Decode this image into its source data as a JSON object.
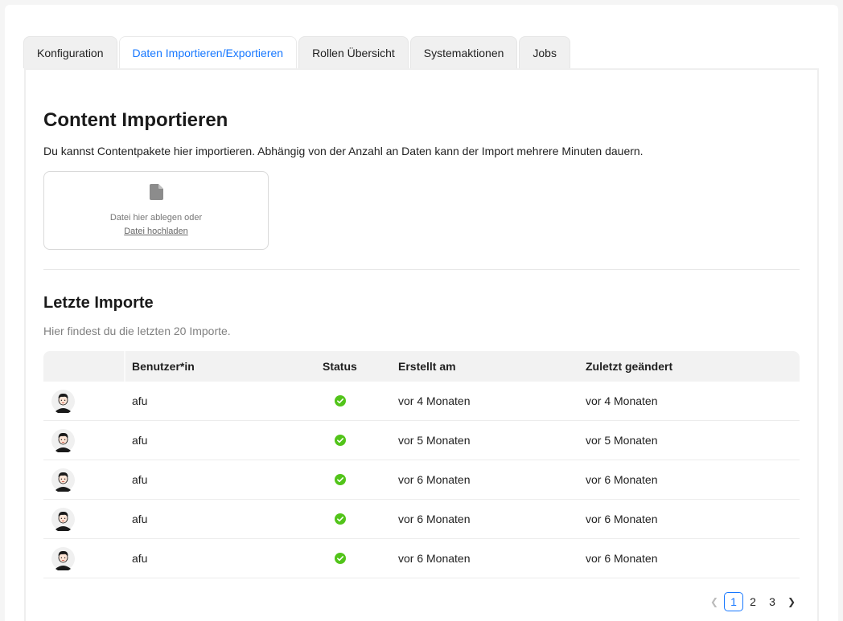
{
  "tabs": [
    {
      "label": "Konfiguration",
      "active": false
    },
    {
      "label": "Daten Importieren/Exportieren",
      "active": true
    },
    {
      "label": "Rollen Übersicht",
      "active": false
    },
    {
      "label": "Systemaktionen",
      "active": false
    },
    {
      "label": "Jobs",
      "active": false
    }
  ],
  "import": {
    "title": "Content Importieren",
    "description": "Du kannst Contentpakete hier importieren. Abhängig von der Anzahl an Daten kann der Import mehrere Minuten dauern.",
    "dropzone_text": "Datei hier ablegen oder",
    "upload_link": "Datei hochladen",
    "icon": "file-icon"
  },
  "recent": {
    "title": "Letzte Importe",
    "subtitle": "Hier findest du die letzten 20 Importe.",
    "columns": [
      "",
      "Benutzer*in",
      "Status",
      "Erstellt am",
      "Zuletzt geändert"
    ],
    "rows": [
      {
        "user": "afu",
        "status": "success",
        "created": "vor 4 Monaten",
        "changed": "vor 4 Monaten"
      },
      {
        "user": "afu",
        "status": "success",
        "created": "vor 5 Monaten",
        "changed": "vor 5 Monaten"
      },
      {
        "user": "afu",
        "status": "success",
        "created": "vor 6 Monaten",
        "changed": "vor 6 Monaten"
      },
      {
        "user": "afu",
        "status": "success",
        "created": "vor 6 Monaten",
        "changed": "vor 6 Monaten"
      },
      {
        "user": "afu",
        "status": "success",
        "created": "vor 6 Monaten",
        "changed": "vor 6 Monaten"
      }
    ]
  },
  "pagination": {
    "pages": [
      "1",
      "2",
      "3"
    ],
    "current": "1",
    "prev_icon": "chevron-left-icon",
    "next_icon": "chevron-right-icon"
  },
  "colors": {
    "accent": "#1677ff",
    "success": "#52c41a",
    "header_bg": "#f2f2f2"
  }
}
